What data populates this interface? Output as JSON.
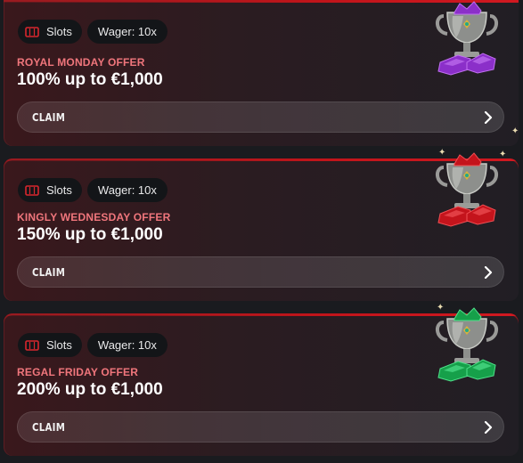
{
  "offers": [
    {
      "category": "Slots",
      "wager": "Wager: 10x",
      "title": "ROYAL MONDAY OFFER",
      "amount": "100% up to €1,000",
      "claim": "CLAIM",
      "gem_color": "#8b2fc9",
      "gem_highlight": "#c070f0",
      "icon": "purple-gem-trophy-icon"
    },
    {
      "category": "Slots",
      "wager": "Wager: 10x",
      "title": "KINGLY WEDNESDAY OFFER",
      "amount": "150% up to €1,000",
      "claim": "CLAIM",
      "gem_color": "#c4141c",
      "gem_highlight": "#f05055",
      "icon": "red-gem-trophy-icon"
    },
    {
      "category": "Slots",
      "wager": "Wager: 10x",
      "title": "REGAL FRIDAY OFFER",
      "amount": "200% up to €1,000",
      "claim": "CLAIM",
      "gem_color": "#16a04a",
      "gem_highlight": "#4fe08a",
      "icon": "green-gem-trophy-icon"
    }
  ],
  "colors": {
    "accent": "#c0141a",
    "label": "#f0767c",
    "chip_bg": "#131518"
  }
}
